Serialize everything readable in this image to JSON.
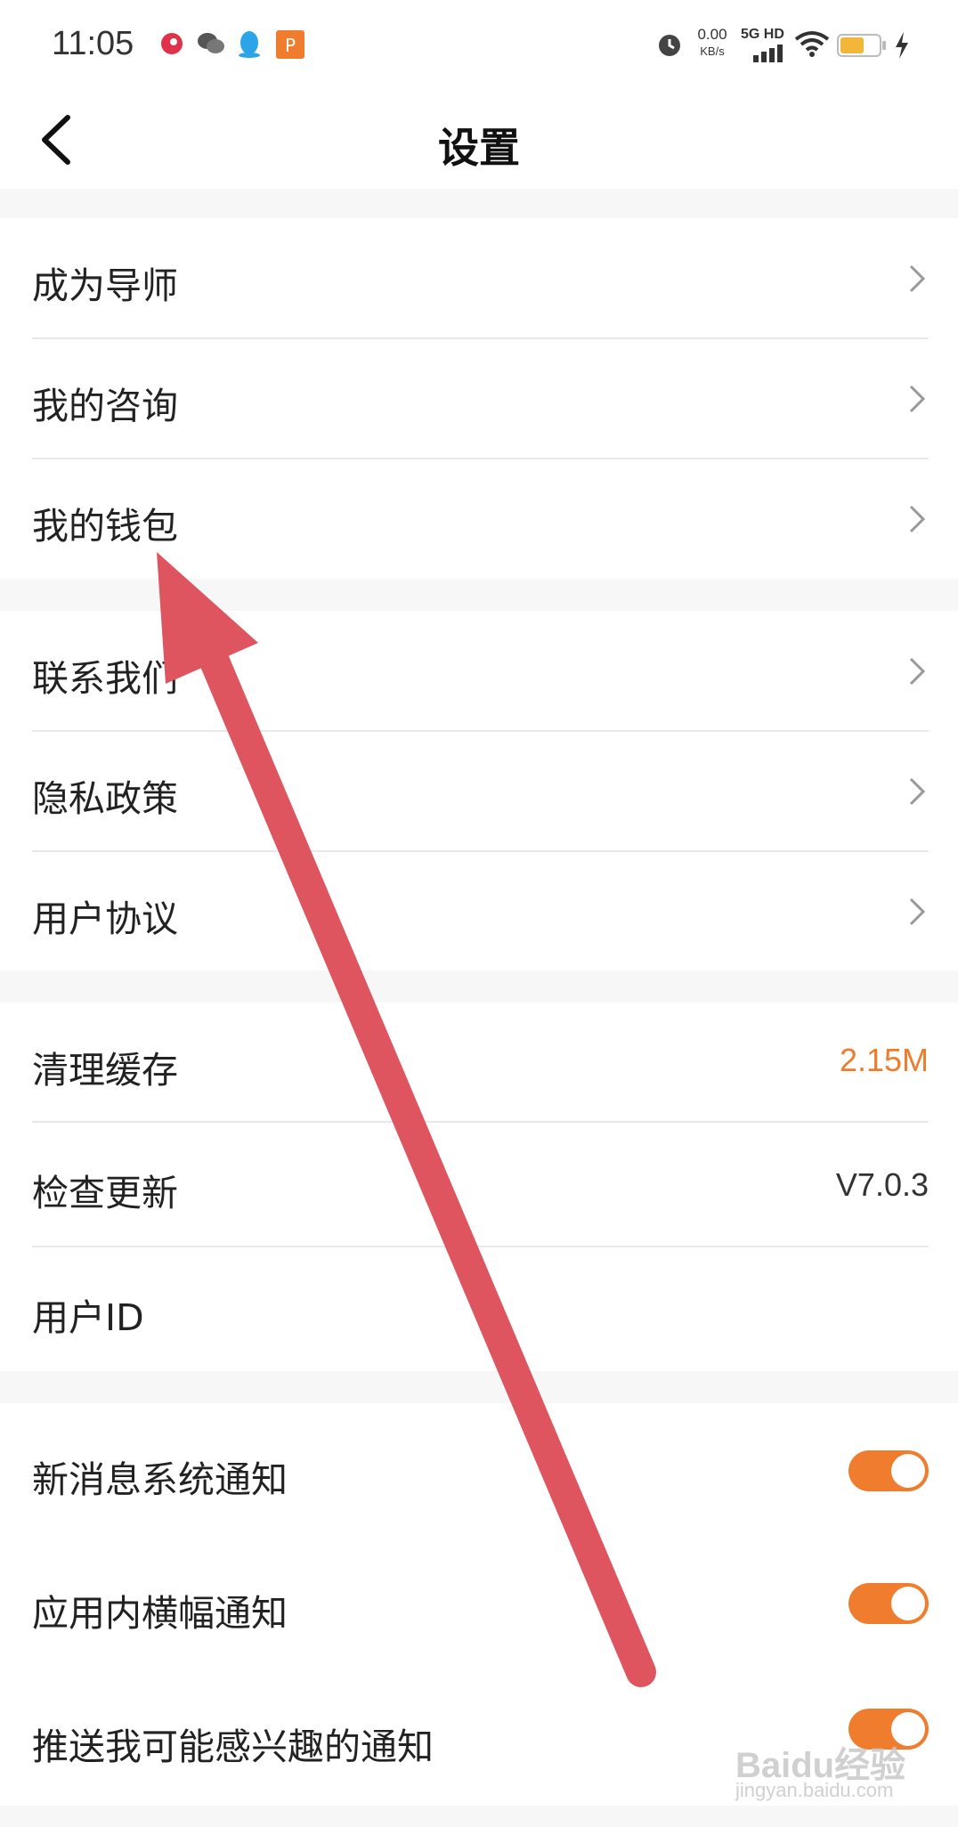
{
  "status_bar": {
    "time": "11:05",
    "speed_value": "0.00",
    "speed_unit": "KB/s",
    "network": "5G HD",
    "left_icons": [
      "weibo-icon",
      "wechat-icon",
      "qq-icon",
      "app-icon"
    ],
    "right_icons": [
      "alarm-icon",
      "signal-icon",
      "wifi-icon",
      "battery-icon",
      "charging-icon"
    ]
  },
  "header": {
    "title": "设置",
    "back_icon": "back-chevron-icon"
  },
  "groups": [
    {
      "items": [
        {
          "label": "成为导师",
          "type": "link"
        },
        {
          "label": "我的咨询",
          "type": "link"
        },
        {
          "label": "我的钱包",
          "type": "link"
        }
      ]
    },
    {
      "items": [
        {
          "label": "联系我们",
          "type": "link"
        },
        {
          "label": "隐私政策",
          "type": "link"
        },
        {
          "label": "用户协议",
          "type": "link"
        }
      ]
    },
    {
      "items": [
        {
          "label": "清理缓存",
          "type": "value",
          "value": "2.15M",
          "value_color": "#ee7d2b"
        },
        {
          "label": "检查更新",
          "type": "value",
          "value": "V7.0.3",
          "value_color": "#333333"
        },
        {
          "label": "用户ID",
          "type": "value",
          "value": ""
        }
      ]
    },
    {
      "items": [
        {
          "label": "新消息系统通知",
          "type": "toggle",
          "on": true
        },
        {
          "label": "应用内横幅通知",
          "type": "toggle",
          "on": true
        },
        {
          "label": "推送我可能感兴趣的通知",
          "type": "toggle",
          "on": true
        }
      ]
    }
  ],
  "colors": {
    "accent": "#f07c2e",
    "annotation_arrow": "#de5560",
    "section_gap": "#f7f7f7"
  },
  "watermark": {
    "brand": "Baidu经验",
    "url": "jingyan.baidu.com"
  }
}
